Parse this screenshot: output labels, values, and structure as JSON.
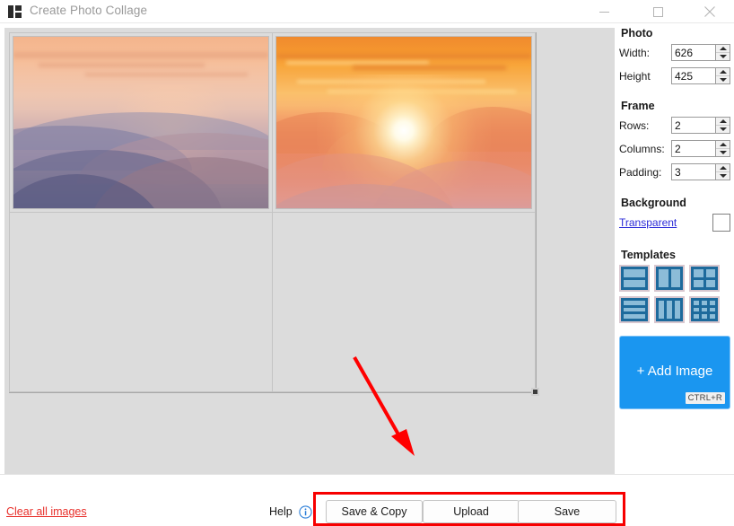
{
  "window": {
    "title": "Create Photo Collage",
    "icon": "collage-grid-icon",
    "controls": {
      "minimize": "minimize-icon",
      "maximize": "maximize-icon",
      "close": "close-icon"
    }
  },
  "panel": {
    "photo": {
      "heading": "Photo",
      "width_label": "Width:",
      "width_value": "626",
      "height_label": "Height",
      "height_value": "425"
    },
    "frame": {
      "heading": "Frame",
      "rows_label": "Rows:",
      "rows_value": "2",
      "columns_label": "Columns:",
      "columns_value": "2",
      "padding_label": "Padding:",
      "padding_value": "3"
    },
    "background": {
      "heading": "Background",
      "transparent_label": "Transparent",
      "swatch_color": "#ffffff"
    },
    "templates": {
      "heading": "Templates",
      "items": [
        {
          "name": "template-2-rows",
          "layout": "r2",
          "cells": 2
        },
        {
          "name": "template-2-columns",
          "layout": "c2",
          "cells": 2
        },
        {
          "name": "template-2x2-grid",
          "layout": "g2",
          "cells": 4
        },
        {
          "name": "template-3-rows",
          "layout": "r3",
          "cells": 3
        },
        {
          "name": "template-3-columns",
          "layout": "c3",
          "cells": 3
        },
        {
          "name": "template-3x3-grid",
          "layout": "g3",
          "cells": 9
        }
      ]
    },
    "add_image": {
      "label": "+ Add Image",
      "shortcut": "CTRL+R",
      "color": "#1a96f0"
    }
  },
  "canvas": {
    "cells": [
      {
        "name": "collage-cell-1",
        "filled": true,
        "image": "hazy-layered-mountains-at-sunset"
      },
      {
        "name": "collage-cell-2",
        "filled": true,
        "image": "orange-sunburst-sunset-over-mountains"
      },
      {
        "name": "collage-cell-3",
        "filled": false,
        "image": ""
      },
      {
        "name": "collage-cell-4",
        "filled": false,
        "image": ""
      }
    ],
    "resize_handle": "collage-resize-handle"
  },
  "annotations": {
    "arrow_color": "#ff0000",
    "highlight_color": "#f70000",
    "arrow_name": "red-pointer-arrow",
    "highlight_name": "action-buttons-highlight"
  },
  "bottom_bar": {
    "clear_all_label": "Clear all images",
    "clear_all_color": "#e8302b",
    "help_label": "Help",
    "help_icon": "info-circle-icon",
    "buttons": [
      {
        "name": "save-and-copy-button",
        "label": "Save & Copy"
      },
      {
        "name": "upload-button",
        "label": "Upload"
      },
      {
        "name": "save-button",
        "label": "Save"
      }
    ]
  }
}
